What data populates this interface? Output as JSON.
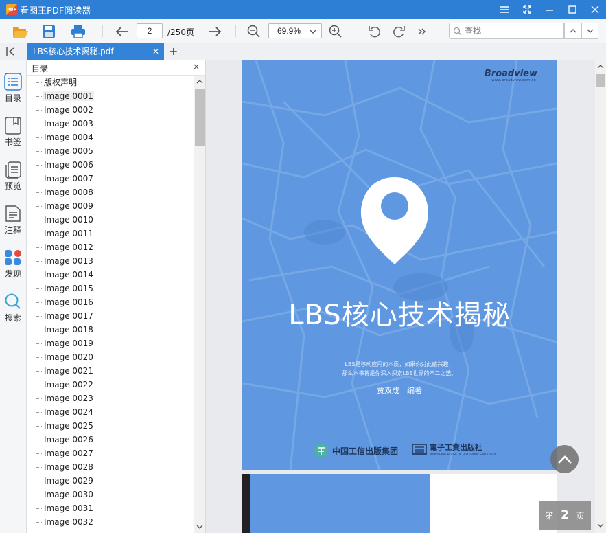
{
  "window": {
    "app_title": "看图王PDF阅读器",
    "logo_text": "PDF",
    "controls": [
      "menu-icon",
      "fullscreen-icon",
      "minimize-icon",
      "maximize-icon",
      "close-icon"
    ]
  },
  "toolbar": {
    "current_page": "2",
    "total_pages": "/250页",
    "zoom": "69.9%",
    "search_placeholder": "查找"
  },
  "tabs": [
    {
      "label": "LBS核心技术揭秘.pdf",
      "close": "✕"
    }
  ],
  "tab_add": "+",
  "left_nav": [
    {
      "label": "目录",
      "icon": "toc-list-icon"
    },
    {
      "label": "书签",
      "icon": "bookmark-icon"
    },
    {
      "label": "预览",
      "icon": "preview-pages-icon"
    },
    {
      "label": "注释",
      "icon": "annotation-icon"
    },
    {
      "label": "发现",
      "icon": "discover-apps-icon"
    },
    {
      "label": "搜索",
      "icon": "search-icon"
    }
  ],
  "toc": {
    "title": "目录",
    "close": "×",
    "items": [
      "版权声明",
      "Image 0001",
      "Image 0002",
      "Image 0003",
      "Image 0004",
      "Image 0005",
      "Image 0006",
      "Image 0007",
      "Image 0008",
      "Image 0009",
      "Image 0010",
      "Image 0011",
      "Image 0012",
      "Image 0013",
      "Image 0014",
      "Image 0015",
      "Image 0016",
      "Image 0017",
      "Image 0018",
      "Image 0019",
      "Image 0020",
      "Image 0021",
      "Image 0022",
      "Image 0023",
      "Image 0024",
      "Image 0025",
      "Image 0026",
      "Image 0027",
      "Image 0028",
      "Image 0029",
      "Image 0030",
      "Image 0031",
      "Image 0032"
    ],
    "selected": "Image 0001"
  },
  "cover": {
    "brand": "Broadview",
    "brand_url": "www.broadview.com.cn",
    "title": "LBS核心技术揭秘",
    "desc_line1": "LBS是移动应用的本质，如果你对此感兴趣，",
    "desc_line2": "那么本书将是你深入探索LBS世界的不二之选。",
    "author": "贾双成　编著",
    "publisher1": "中国工信出版集团",
    "publisher2": "電子工業出版社",
    "publisher2_en": "PUBLISHING HOUSE OF ELECTRONICS INDUSTRY",
    "color": "#5f97e0"
  },
  "page_indicator": {
    "prefix": "第",
    "number": "2",
    "suffix": "页"
  },
  "colors": {
    "titlebar": "#2d7fd6",
    "tab_active": "#3383d8",
    "icon_blue": "#2f7fd3",
    "icon_gold": "#f0a830"
  }
}
